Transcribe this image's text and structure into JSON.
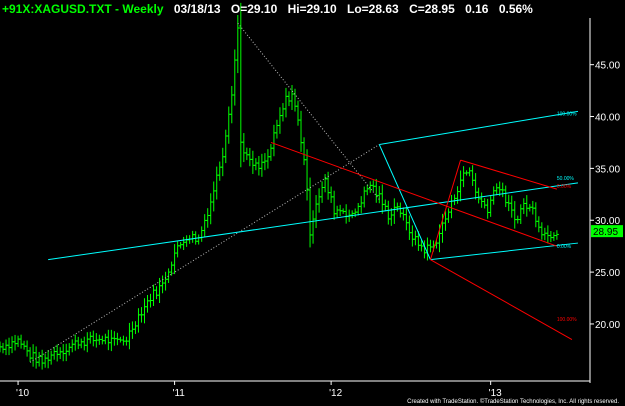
{
  "header": {
    "symbol": "+91X:XAGUSD.TXT - Weekly",
    "date": "03/18/13",
    "open": "O=29.10",
    "high": "Hi=29.10",
    "low": "Lo=28.63",
    "close": "C=28.95",
    "change": "0.16",
    "change_pct": "0.56%"
  },
  "credit": "Created with TradeStation. ©TradeStation Technologies, Inc. All rights reserved.",
  "colors": {
    "background": "#000000",
    "bars": "#00ff00",
    "pitchfork_cyan": "#00ffff",
    "pitchfork_red": "#ff0000",
    "trend_dotted": "#bbbbbb",
    "axis_text": "#ffffff",
    "header_symbol": "#00ff00",
    "header_text": "#ffffff",
    "price_tag_bg": "#00ff00",
    "price_tag_text": "#000000"
  },
  "chart_data": {
    "type": "ohlc",
    "ylim": [
      14.5,
      49.5
    ],
    "xlim": [
      0,
      196
    ],
    "yticks": [
      45,
      40,
      35,
      30,
      25,
      20
    ],
    "ytick_labels": [
      "45.00",
      "40.00",
      "35.00",
      "30.00",
      "25.00",
      "20.00"
    ],
    "xticks": [
      {
        "label": "'10",
        "week": 6
      },
      {
        "label": "'11",
        "week": 58
      },
      {
        "label": "'12",
        "week": 110
      },
      {
        "label": "'13",
        "week": 163
      }
    ],
    "last_price": "28.95",
    "anchors": [
      [
        0,
        17.8
      ],
      [
        6,
        18.4
      ],
      [
        10,
        17.0
      ],
      [
        14,
        16.3
      ],
      [
        18,
        17.3
      ],
      [
        22,
        17.6
      ],
      [
        26,
        18.3
      ],
      [
        30,
        18.4
      ],
      [
        34,
        18.6
      ],
      [
        38,
        18.2
      ],
      [
        42,
        18.6
      ],
      [
        46,
        20.8
      ],
      [
        50,
        22.6
      ],
      [
        54,
        23.8
      ],
      [
        58,
        26.8
      ],
      [
        62,
        28.5
      ],
      [
        66,
        28.2
      ],
      [
        70,
        31.8
      ],
      [
        74,
        36.5
      ],
      [
        77,
        42.5
      ],
      [
        79,
        48.5
      ],
      [
        80,
        37.5
      ],
      [
        83,
        35.5
      ],
      [
        86,
        35.0
      ],
      [
        89,
        36.0
      ],
      [
        92,
        39.0
      ],
      [
        95,
        41.6
      ],
      [
        97,
        42.2
      ],
      [
        99,
        39.5
      ],
      [
        101,
        36.0
      ],
      [
        103,
        29.0
      ],
      [
        105,
        31.8
      ],
      [
        108,
        33.7
      ],
      [
        111,
        31.0
      ],
      [
        114,
        31.0
      ],
      [
        117,
        30.3
      ],
      [
        120,
        32.0
      ],
      [
        123,
        33.5
      ],
      [
        126,
        32.2
      ],
      [
        129,
        30.5
      ],
      [
        132,
        31.5
      ],
      [
        135,
        29.5
      ],
      [
        138,
        28.0
      ],
      [
        141,
        27.2
      ],
      [
        144,
        27.5
      ],
      [
        147,
        29.5
      ],
      [
        150,
        31.5
      ],
      [
        153,
        34.0
      ],
      [
        156,
        34.8
      ],
      [
        159,
        32.0
      ],
      [
        162,
        31.2
      ],
      [
        165,
        33.5
      ],
      [
        168,
        32.0
      ],
      [
        171,
        30.0
      ],
      [
        174,
        31.5
      ],
      [
        177,
        31.0
      ],
      [
        180,
        29.0
      ],
      [
        182,
        28.5
      ],
      [
        184,
        28.9
      ],
      [
        185,
        28.95
      ]
    ],
    "median_line": {
      "from": [
        16,
        26.2
      ],
      "to": [
        192,
        33.6
      ]
    },
    "pitchfork_cyan": {
      "median": {
        "from": [
          126,
          37.3
        ],
        "to": [
          192,
          40.5
        ]
      },
      "lower": {
        "from": [
          143,
          26.2
        ],
        "to": [
          192,
          27.8
        ]
      },
      "pivot_top": [
        126,
        37.3
      ],
      "pivot_low": [
        143,
        26.2
      ],
      "labels": [
        {
          "text": "100.00%",
          "at": [
            185,
            40.1
          ]
        },
        {
          "text": "50.00%",
          "at": [
            185,
            33.9
          ]
        },
        {
          "text": "0.00%",
          "at": [
            185,
            27.3
          ]
        }
      ]
    },
    "pitchfork_red": {
      "lines": [
        {
          "from": [
            90,
            37.5
          ],
          "to": [
            185,
            27.5
          ]
        },
        {
          "from": [
            143,
            26.2
          ],
          "to": [
            190,
            18.5
          ]
        },
        {
          "from": [
            153,
            35.8
          ],
          "to": [
            185,
            33.0
          ]
        },
        {
          "from": [
            143,
            26.2
          ],
          "to": [
            153,
            35.8
          ]
        }
      ],
      "labels": [
        {
          "text": "0.00%",
          "at": [
            185,
            33.1
          ]
        },
        {
          "text": "100.00%",
          "at": [
            185,
            20.3
          ]
        }
      ]
    },
    "trend_dotted": [
      {
        "from": [
          79,
          49.0
        ],
        "to": [
          126,
          32.0
        ]
      },
      {
        "from": [
          10,
          16.3
        ],
        "to": [
          126,
          37.3
        ]
      }
    ]
  }
}
